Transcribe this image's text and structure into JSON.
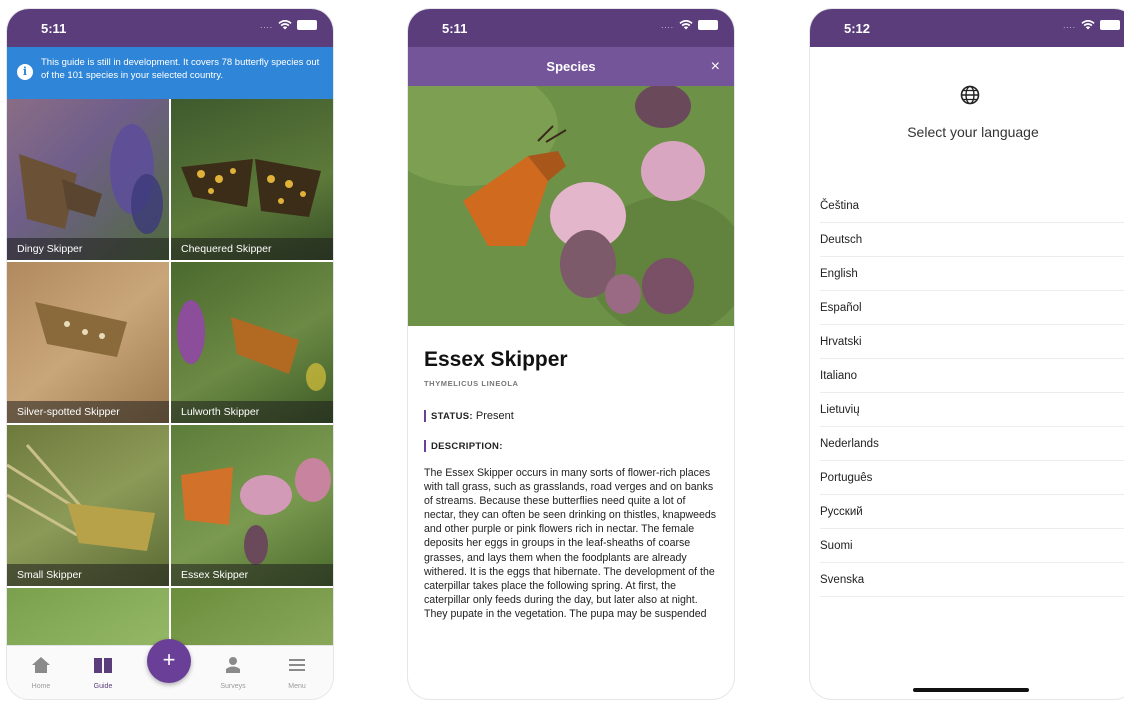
{
  "phone1": {
    "status": {
      "time": "5:11"
    },
    "banner": {
      "icon": "info-icon",
      "text": "This guide is still in development. It covers 78 butterfly species out of the 101 species in your selected country."
    },
    "species": [
      {
        "name": "Dingy Skipper"
      },
      {
        "name": "Chequered Skipper"
      },
      {
        "name": "Silver-spotted Skipper"
      },
      {
        "name": "Lulworth Skipper"
      },
      {
        "name": "Small Skipper"
      },
      {
        "name": "Essex Skipper"
      }
    ],
    "nav": {
      "home": "Home",
      "guide": "Guide",
      "add": "+",
      "surveys": "Surveys",
      "menu": "Menu"
    },
    "colors": {
      "primary": "#5b3d7c",
      "banner": "#2f86d8",
      "fab": "#6a3f98"
    }
  },
  "phone2": {
    "status": {
      "time": "5:11"
    },
    "header": {
      "title": "Species",
      "close": "×"
    },
    "species": {
      "name": "Essex Skipper",
      "latin": "THYMELICUS LINEOLA",
      "status_label": "STATUS:",
      "status_value": "Present",
      "description_label": "DESCRIPTION:",
      "description": "The Essex Skipper occurs in many sorts of flower-rich places with tall grass, such as grasslands, road verges and on banks of streams. Because these butterflies need quite a lot of nectar, they can often be seen drinking on thistles, knapweeds and other purple or pink flowers rich in nectar. The female deposits her eggs in groups in the leaf-sheaths of coarse grasses, and lays them when the foodplants are already withered. It is the eggs that hibernate. The development of the caterpillar takes place the following spring. At first, the caterpillar only feeds during the day, but later also at night. They pupate in the vegetation. The pupa may be suspended"
    }
  },
  "phone3": {
    "status": {
      "time": "5:12"
    },
    "title": "Select your language",
    "icon": "globe-icon",
    "languages": [
      "Čeština",
      "Deutsch",
      "English",
      "Español",
      "Hrvatski",
      "Italiano",
      "Lietuvių",
      "Nederlands",
      "Português",
      "Русский",
      "Suomi",
      "Svenska"
    ]
  }
}
